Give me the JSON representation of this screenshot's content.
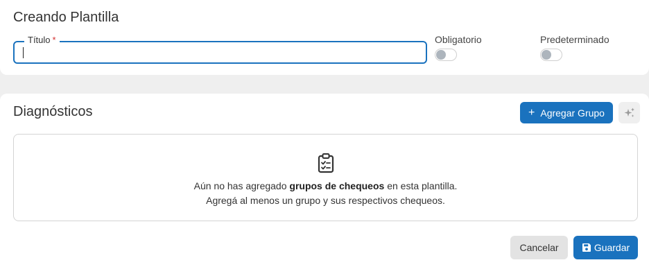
{
  "template": {
    "title": "Creando Plantilla",
    "titulo_field": {
      "label": "Título",
      "required_mark": "*",
      "value": ""
    },
    "toggles": [
      {
        "label": "Obligatorio",
        "on": false
      },
      {
        "label": "Predeterminado",
        "on": false
      }
    ]
  },
  "diagnostics": {
    "title": "Diagnósticos",
    "add_group_button": {
      "icon": "plus-icon",
      "label": "Agregar Grupo"
    },
    "ai_button": {
      "icon": "sparkle-icon"
    },
    "empty_state": {
      "icon": "clipboard-check-icon",
      "line1_before": "Aún no has agregado ",
      "line1_bold": "grupos de chequeos",
      "line1_after": " en esta plantilla.",
      "line2": "Agregá al menos un grupo y sus respectivos chequeos."
    }
  },
  "footer": {
    "cancel_label": "Cancelar",
    "save_label": "Guardar",
    "save_icon": "floppy-disk-icon"
  },
  "colors": {
    "primary": "#1a72be",
    "page_bg": "#efefef",
    "required": "#d32f2f"
  }
}
